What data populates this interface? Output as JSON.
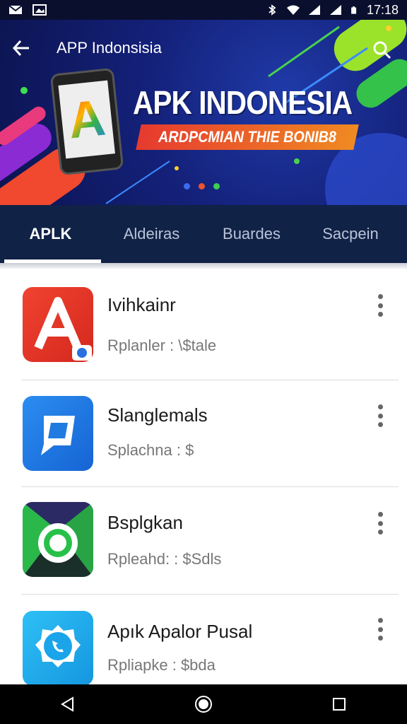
{
  "status_bar": {
    "time": "17:18",
    "icons": [
      "gmail-icon",
      "image-icon",
      "bluetooth-icon",
      "wifi-icon",
      "signal-icon",
      "signal-icon",
      "battery-icon"
    ]
  },
  "header": {
    "title": "APP Indonsisia",
    "back_icon": "back-arrow-icon",
    "action_icon": "search-icon"
  },
  "banner": {
    "headline": "APK INDONESIA",
    "ribbon": "ARDPCMIAN THIE BONIB8",
    "phone_logo": "A",
    "colors": {
      "bg": "#14217a",
      "ribbon_start": "#e63a2f",
      "ribbon_end": "#f08a22"
    }
  },
  "tabs": [
    {
      "label": "APLK",
      "active": true
    },
    {
      "label": "Aldeiras",
      "active": false
    },
    {
      "label": "Buardes",
      "active": false
    },
    {
      "label": "Sacpein",
      "active": false
    }
  ],
  "apps": [
    {
      "title": "Ivihkainr",
      "subtitle": "Rplanler : \\$tale",
      "icon": "apk-a-icon",
      "color": "#e5362a"
    },
    {
      "title": "Slanglemals",
      "subtitle": "Splachna : $",
      "icon": "chat-bubble-icon",
      "color": "#1f7be0"
    },
    {
      "title": "Bsplgkan",
      "subtitle": "Rpleahd: : $Sdls",
      "icon": "green-ring-icon",
      "color": "#1b2f2a"
    },
    {
      "title": "Apık Apalor Pusal",
      "subtitle": "Rpliapke : $bda",
      "icon": "phone-badge-icon",
      "color": "#1aa4ea"
    }
  ],
  "nav": {
    "back": "nav-back-icon",
    "home": "nav-home-icon",
    "recents": "nav-recents-icon"
  }
}
